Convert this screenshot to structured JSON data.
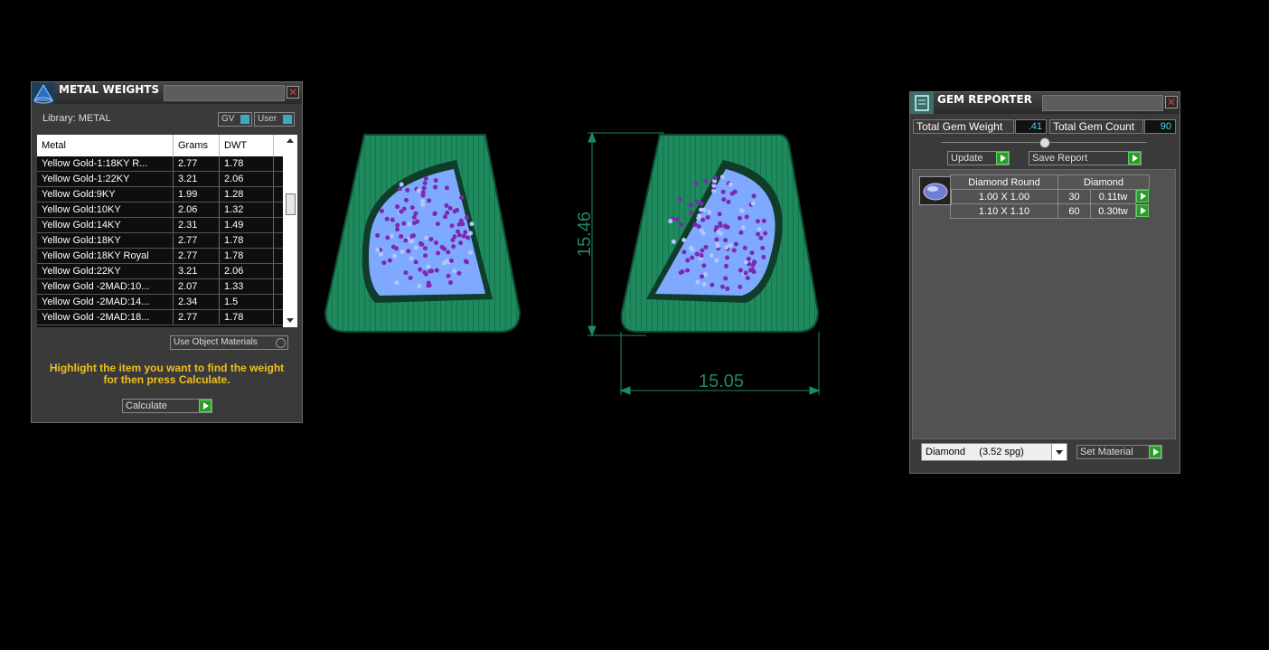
{
  "metal_weights": {
    "title": "METAL WEIGHTS",
    "library_label": "Library: METAL",
    "gv_label": "GV",
    "user_label": "User",
    "columns": [
      "Metal",
      "Grams",
      "DWT"
    ],
    "rows": [
      [
        "Yellow Gold-1:18KY R...",
        "2.77",
        "1.78"
      ],
      [
        "Yellow Gold-1:22KY",
        "3.21",
        "2.06"
      ],
      [
        "Yellow Gold:9KY",
        "1.99",
        "1.28"
      ],
      [
        "Yellow Gold:10KY",
        "2.06",
        "1.32"
      ],
      [
        "Yellow Gold:14KY",
        "2.31",
        "1.49"
      ],
      [
        "Yellow Gold:18KY",
        "2.77",
        "1.78"
      ],
      [
        "Yellow Gold:18KY Royal",
        "2.77",
        "1.78"
      ],
      [
        "Yellow Gold:22KY",
        "3.21",
        "2.06"
      ],
      [
        "Yellow Gold -2MAD:10...",
        "2.07",
        "1.33"
      ],
      [
        "Yellow Gold -2MAD:14...",
        "2.34",
        "1.5"
      ],
      [
        "Yellow Gold -2MAD:18...",
        "2.77",
        "1.78"
      ]
    ],
    "use_object_materials": "Use Object Materials",
    "hint_line1": "Highlight the item you want to find the weight",
    "hint_line2": "for then press Calculate.",
    "calculate_label": "Calculate"
  },
  "drawing": {
    "height_dim": "15.46",
    "width_dim": "15.05",
    "metal_color": "#1e8a5e",
    "gem_color": "#7fa8ff",
    "prong_color": "#7a2ab0"
  },
  "gem_reporter": {
    "title": "GEM REPORTER",
    "total_weight_label": "Total Gem Weight",
    "total_weight_value": ".41",
    "total_count_label": "Total Gem Count",
    "total_count_value": "90",
    "update_label": "Update",
    "save_report_label": "Save Report",
    "table_header_shape": "Diamond Round",
    "table_header_material": "Diamond",
    "rows": [
      {
        "size": "1.00 X 1.00",
        "count": "30",
        "weight": "0.11tw"
      },
      {
        "size": "1.10 X 1.10",
        "count": "60",
        "weight": "0.30tw"
      }
    ],
    "material_select": "Diamond     (3.52 spg)",
    "set_material_label": "Set Material"
  }
}
